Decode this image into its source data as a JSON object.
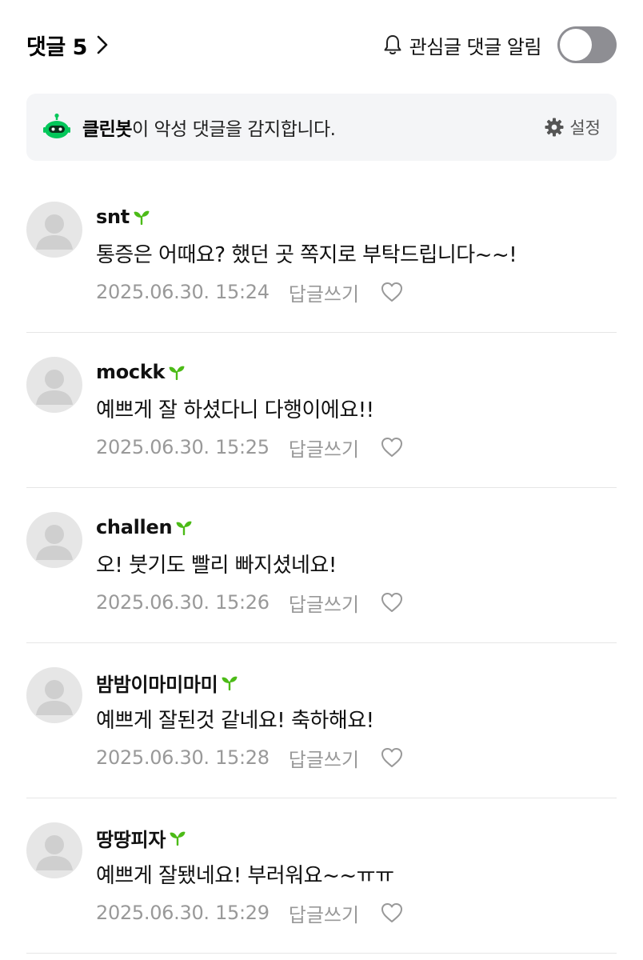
{
  "header": {
    "comment_label": "댓글 5",
    "notify_label": "관심글 댓글 알림",
    "notify_toggle_on": false
  },
  "cleanbot": {
    "name": "클린봇",
    "message": "이 악성 댓글을 감지합니다.",
    "settings_label": "설정",
    "accent_color": "#03c75a"
  },
  "comments": [
    {
      "nickname": "snt",
      "text": "통증은 어때요? 했던 곳 쪽지로 부탁드립니다~~!",
      "date": "2025.06.30. 15:24",
      "reply_label": "답글쓰기"
    },
    {
      "nickname": "mockk",
      "text": "예쁘게 잘 하셨다니 다행이에요!!",
      "date": "2025.06.30. 15:25",
      "reply_label": "답글쓰기"
    },
    {
      "nickname": "challen",
      "text": "오! 붓기도 빨리 빠지셨네요!",
      "date": "2025.06.30. 15:26",
      "reply_label": "답글쓰기"
    },
    {
      "nickname": "밤밤이마미마미",
      "text": "예쁘게 잘된것 같네요! 축하해요!",
      "date": "2025.06.30. 15:28",
      "reply_label": "답글쓰기"
    },
    {
      "nickname": "땅땅피자",
      "text": "예쁘게 잘됐네요! 부러워요~~ㅠㅠ",
      "date": "2025.06.30. 15:29",
      "reply_label": "답글쓰기"
    }
  ],
  "icons": {
    "chevron": "chevron-right-icon",
    "bell": "bell-icon",
    "robot": "robot-icon",
    "gear": "gear-icon",
    "sprout": "sprout-icon",
    "heart": "heart-icon",
    "avatar": "default-avatar-icon"
  }
}
